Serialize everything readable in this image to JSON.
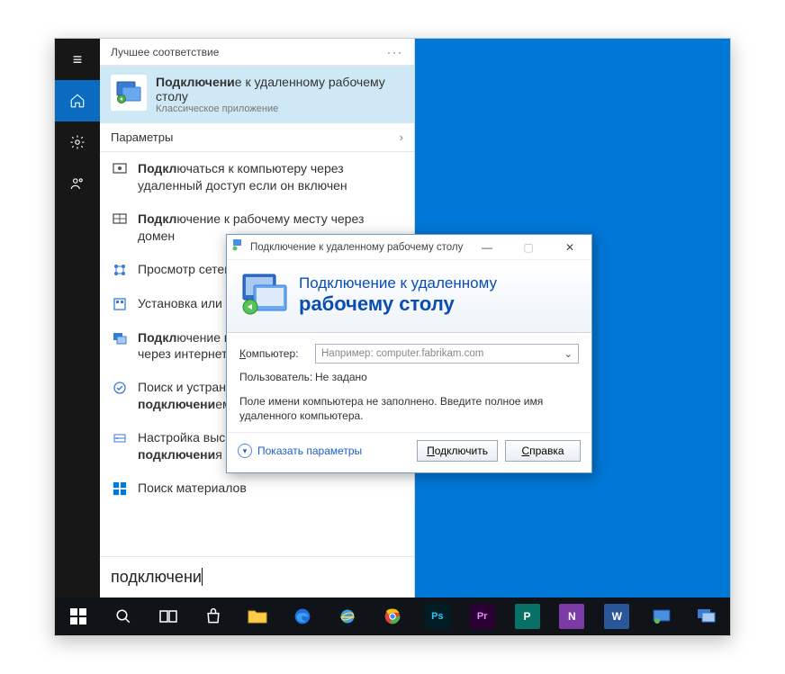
{
  "search": {
    "best_match_header": "Лучшее соответствие",
    "best_title_pre": "Подключени",
    "best_title_bold": "е",
    "best_title_post": " к удаленному рабочему столу",
    "best_subtitle": "Классическое приложение",
    "parameters_header": "Параметры",
    "items": [
      {
        "pre": "",
        "b": "Подкл",
        "mid": "ючаться к компьютеру через удаленный доступ если он включен"
      },
      {
        "pre": "",
        "b": "Подкл",
        "mid": "ючение к рабочему месту через домен"
      },
      {
        "pre": "Прос",
        "b": "",
        "mid": "мотр сетевых компьютеров и устройств"
      },
      {
        "pre": "Устан",
        "b": "",
        "mid": "овка или удаление программ"
      },
      {
        "pre": "",
        "b": "Подкл",
        "mid": "ючение к удаленному рабочему столу через интернет"
      },
      {
        "pre": "Поиск и устранение проблем с сетью и ",
        "b": "подключени",
        "mid": "ем"
      },
      {
        "pre": "Настройка высокоскоростного ",
        "b": "подключени",
        "mid": "я"
      },
      {
        "pre": "Поиск материалов",
        "b": "",
        "mid": ""
      }
    ],
    "input_value": "подключени"
  },
  "dialog": {
    "title": "Подключение к удаленному рабочему столу",
    "banner_line1": "Подключение к удаленному",
    "banner_line2": "рабочему столу",
    "computer_label": "Компьютер:",
    "computer_placeholder": "Например: computer.fabrikam.com",
    "user_label": "Пользователь:",
    "user_value": "Не задано",
    "note": "Поле имени компьютера не заполнено. Введите полное имя удаленного компьютера.",
    "show_options": "Показать параметры",
    "connect_label": "Подключить",
    "help_label": "Справка"
  },
  "taskbar": {}
}
